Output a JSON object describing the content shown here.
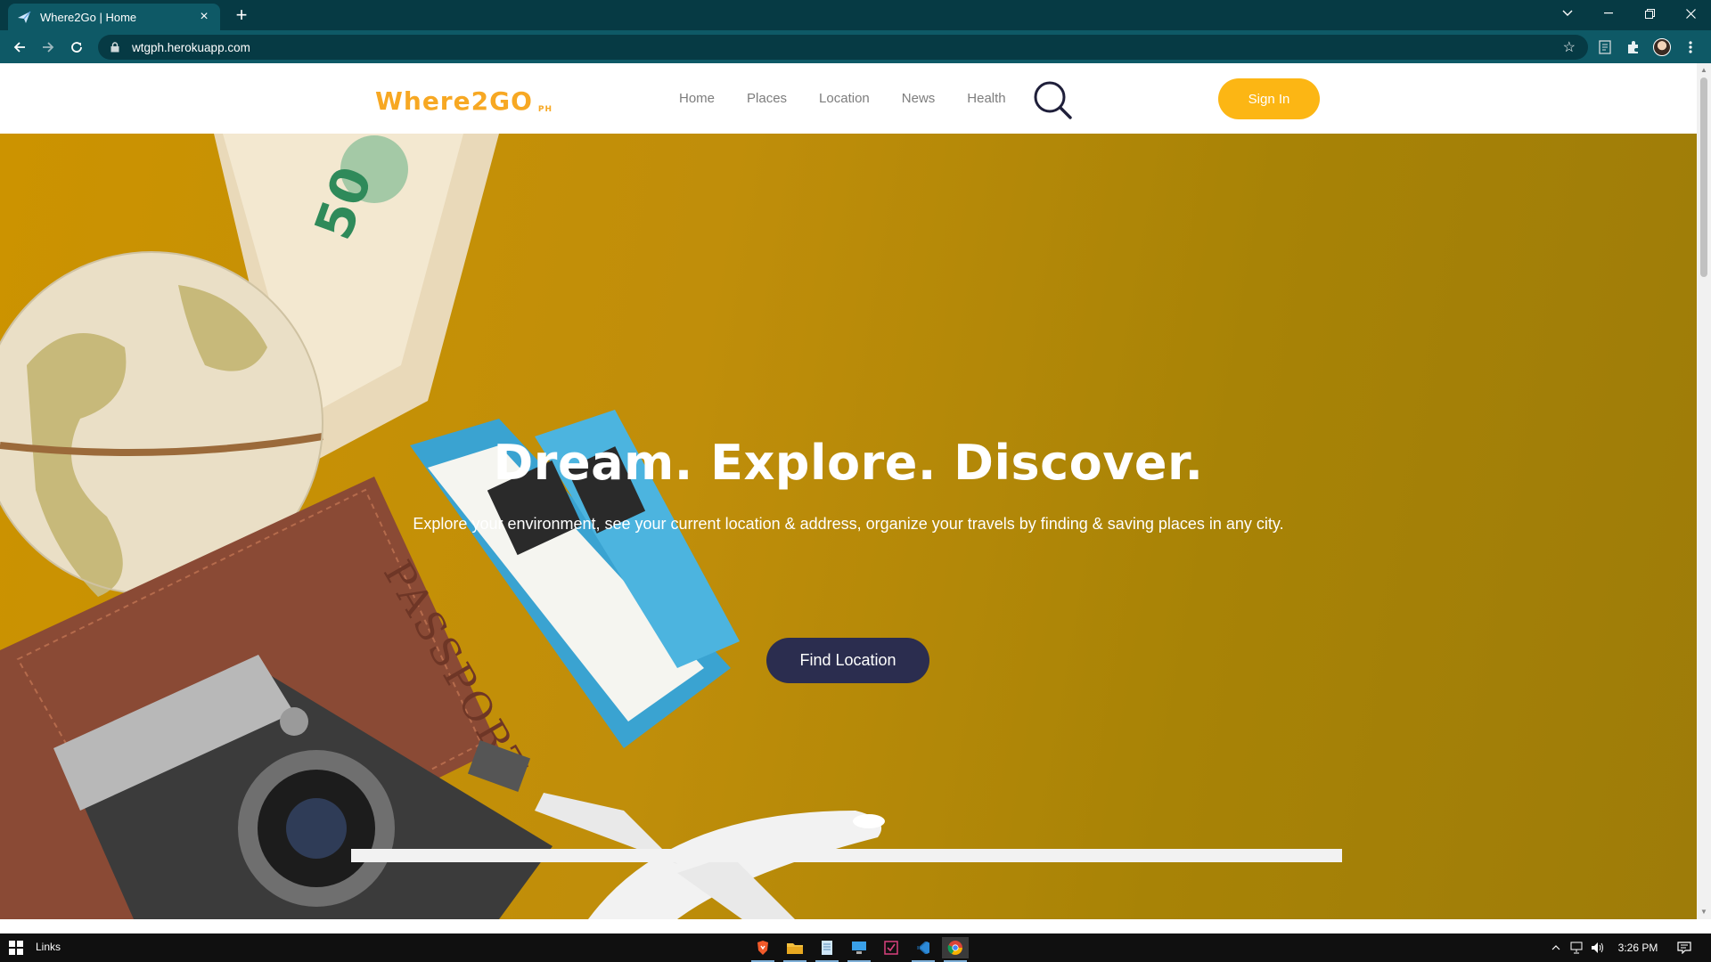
{
  "browser": {
    "tab_title": "Where2Go | Home",
    "url": "wtgph.herokuapp.com"
  },
  "site": {
    "logo_main": "Where2GO",
    "logo_sub": "PH",
    "nav": [
      "Home",
      "Places",
      "Location",
      "News",
      "Health"
    ],
    "sign_in": "Sign In"
  },
  "hero": {
    "title": "Dream. Explore. Discover.",
    "subtitle": "Explore your environment, see your current location & address, organize your travels by finding & saving places in any city.",
    "button": "Find Location"
  },
  "taskbar": {
    "links_label": "Links",
    "time": "3:26 PM"
  },
  "colors": {
    "brand_orange": "#f7a823",
    "sign_in_bg": "#fcb614",
    "hero_bg": "#c08e0a",
    "button_dark": "#2b2d4f",
    "chrome_teal": "#0e5966"
  }
}
